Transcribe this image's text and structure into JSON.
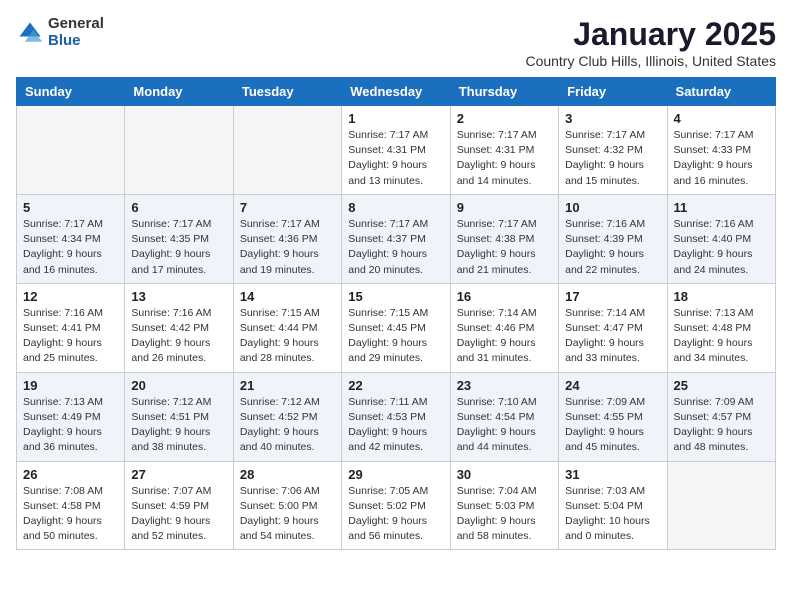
{
  "logo": {
    "general": "General",
    "blue": "Blue"
  },
  "title": "January 2025",
  "subtitle": "Country Club Hills, Illinois, United States",
  "days_of_week": [
    "Sunday",
    "Monday",
    "Tuesday",
    "Wednesday",
    "Thursday",
    "Friday",
    "Saturday"
  ],
  "weeks": [
    [
      {
        "day": "",
        "info": ""
      },
      {
        "day": "",
        "info": ""
      },
      {
        "day": "",
        "info": ""
      },
      {
        "day": "1",
        "info": "Sunrise: 7:17 AM\nSunset: 4:31 PM\nDaylight: 9 hours\nand 13 minutes."
      },
      {
        "day": "2",
        "info": "Sunrise: 7:17 AM\nSunset: 4:31 PM\nDaylight: 9 hours\nand 14 minutes."
      },
      {
        "day": "3",
        "info": "Sunrise: 7:17 AM\nSunset: 4:32 PM\nDaylight: 9 hours\nand 15 minutes."
      },
      {
        "day": "4",
        "info": "Sunrise: 7:17 AM\nSunset: 4:33 PM\nDaylight: 9 hours\nand 16 minutes."
      }
    ],
    [
      {
        "day": "5",
        "info": "Sunrise: 7:17 AM\nSunset: 4:34 PM\nDaylight: 9 hours\nand 16 minutes."
      },
      {
        "day": "6",
        "info": "Sunrise: 7:17 AM\nSunset: 4:35 PM\nDaylight: 9 hours\nand 17 minutes."
      },
      {
        "day": "7",
        "info": "Sunrise: 7:17 AM\nSunset: 4:36 PM\nDaylight: 9 hours\nand 19 minutes."
      },
      {
        "day": "8",
        "info": "Sunrise: 7:17 AM\nSunset: 4:37 PM\nDaylight: 9 hours\nand 20 minutes."
      },
      {
        "day": "9",
        "info": "Sunrise: 7:17 AM\nSunset: 4:38 PM\nDaylight: 9 hours\nand 21 minutes."
      },
      {
        "day": "10",
        "info": "Sunrise: 7:16 AM\nSunset: 4:39 PM\nDaylight: 9 hours\nand 22 minutes."
      },
      {
        "day": "11",
        "info": "Sunrise: 7:16 AM\nSunset: 4:40 PM\nDaylight: 9 hours\nand 24 minutes."
      }
    ],
    [
      {
        "day": "12",
        "info": "Sunrise: 7:16 AM\nSunset: 4:41 PM\nDaylight: 9 hours\nand 25 minutes."
      },
      {
        "day": "13",
        "info": "Sunrise: 7:16 AM\nSunset: 4:42 PM\nDaylight: 9 hours\nand 26 minutes."
      },
      {
        "day": "14",
        "info": "Sunrise: 7:15 AM\nSunset: 4:44 PM\nDaylight: 9 hours\nand 28 minutes."
      },
      {
        "day": "15",
        "info": "Sunrise: 7:15 AM\nSunset: 4:45 PM\nDaylight: 9 hours\nand 29 minutes."
      },
      {
        "day": "16",
        "info": "Sunrise: 7:14 AM\nSunset: 4:46 PM\nDaylight: 9 hours\nand 31 minutes."
      },
      {
        "day": "17",
        "info": "Sunrise: 7:14 AM\nSunset: 4:47 PM\nDaylight: 9 hours\nand 33 minutes."
      },
      {
        "day": "18",
        "info": "Sunrise: 7:13 AM\nSunset: 4:48 PM\nDaylight: 9 hours\nand 34 minutes."
      }
    ],
    [
      {
        "day": "19",
        "info": "Sunrise: 7:13 AM\nSunset: 4:49 PM\nDaylight: 9 hours\nand 36 minutes."
      },
      {
        "day": "20",
        "info": "Sunrise: 7:12 AM\nSunset: 4:51 PM\nDaylight: 9 hours\nand 38 minutes."
      },
      {
        "day": "21",
        "info": "Sunrise: 7:12 AM\nSunset: 4:52 PM\nDaylight: 9 hours\nand 40 minutes."
      },
      {
        "day": "22",
        "info": "Sunrise: 7:11 AM\nSunset: 4:53 PM\nDaylight: 9 hours\nand 42 minutes."
      },
      {
        "day": "23",
        "info": "Sunrise: 7:10 AM\nSunset: 4:54 PM\nDaylight: 9 hours\nand 44 minutes."
      },
      {
        "day": "24",
        "info": "Sunrise: 7:09 AM\nSunset: 4:55 PM\nDaylight: 9 hours\nand 45 minutes."
      },
      {
        "day": "25",
        "info": "Sunrise: 7:09 AM\nSunset: 4:57 PM\nDaylight: 9 hours\nand 48 minutes."
      }
    ],
    [
      {
        "day": "26",
        "info": "Sunrise: 7:08 AM\nSunset: 4:58 PM\nDaylight: 9 hours\nand 50 minutes."
      },
      {
        "day": "27",
        "info": "Sunrise: 7:07 AM\nSunset: 4:59 PM\nDaylight: 9 hours\nand 52 minutes."
      },
      {
        "day": "28",
        "info": "Sunrise: 7:06 AM\nSunset: 5:00 PM\nDaylight: 9 hours\nand 54 minutes."
      },
      {
        "day": "29",
        "info": "Sunrise: 7:05 AM\nSunset: 5:02 PM\nDaylight: 9 hours\nand 56 minutes."
      },
      {
        "day": "30",
        "info": "Sunrise: 7:04 AM\nSunset: 5:03 PM\nDaylight: 9 hours\nand 58 minutes."
      },
      {
        "day": "31",
        "info": "Sunrise: 7:03 AM\nSunset: 5:04 PM\nDaylight: 10 hours\nand 0 minutes."
      },
      {
        "day": "",
        "info": ""
      }
    ]
  ]
}
